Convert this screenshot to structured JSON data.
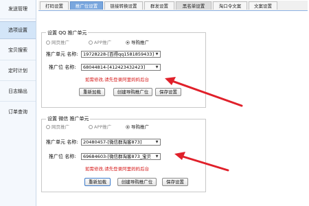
{
  "sidebar": {
    "items": [
      {
        "label": "发送管理"
      },
      {
        "label": "选项设置"
      },
      {
        "label": "宝贝搜索"
      },
      {
        "label": "定时计划"
      },
      {
        "label": "日志输出"
      },
      {
        "label": "订单查询"
      }
    ],
    "active_index": 1
  },
  "tabs": [
    {
      "label": "打码设置"
    },
    {
      "label": "推广位设置"
    },
    {
      "label": "链接转换设置"
    },
    {
      "label": "群发设置"
    },
    {
      "label": "黑名单设置"
    },
    {
      "label": "淘口令文案"
    },
    {
      "label": "文案设置"
    }
  ],
  "qq_group": {
    "title": "设置 QQ 推广单元",
    "radios": [
      {
        "label": "网页推广",
        "checked": false
      },
      {
        "label": "APP推广",
        "checked": false
      },
      {
        "label": "导购推广",
        "checked": true
      }
    ],
    "unit_label": "推广单元 名称:",
    "unit_value": "19728228-[百得qq1581859433]",
    "position_label": "推广位 名称:",
    "position_value": "68044814-[412423432423]",
    "warning": "如需修改,请先登录阿里妈妈后台",
    "buttons": {
      "reload": "重新加载",
      "create": "创建导购推广位",
      "save": "保存设置"
    }
  },
  "wechat_group": {
    "title": "设置 微信 推广单元",
    "radios": [
      {
        "label": "网页推广",
        "checked": false
      },
      {
        "label": "APP推广",
        "checked": false
      },
      {
        "label": "导购推广",
        "checked": true
      }
    ],
    "unit_label": "推广单元 名称:",
    "unit_value": "20480457-[微信群淘客873]",
    "position_label": "推广位 名称:",
    "position_value": "69684603-[微信群淘客873_宝贝",
    "warning": "如需修改,请先登录阿里妈妈后台",
    "buttons": {
      "reload": "重新加载",
      "create": "创建导购推广位",
      "save": "保存设置"
    }
  },
  "colors": {
    "accent": "#7aa7de",
    "warning": "#d61b1b",
    "annotation_arrow": "#e0202a"
  }
}
